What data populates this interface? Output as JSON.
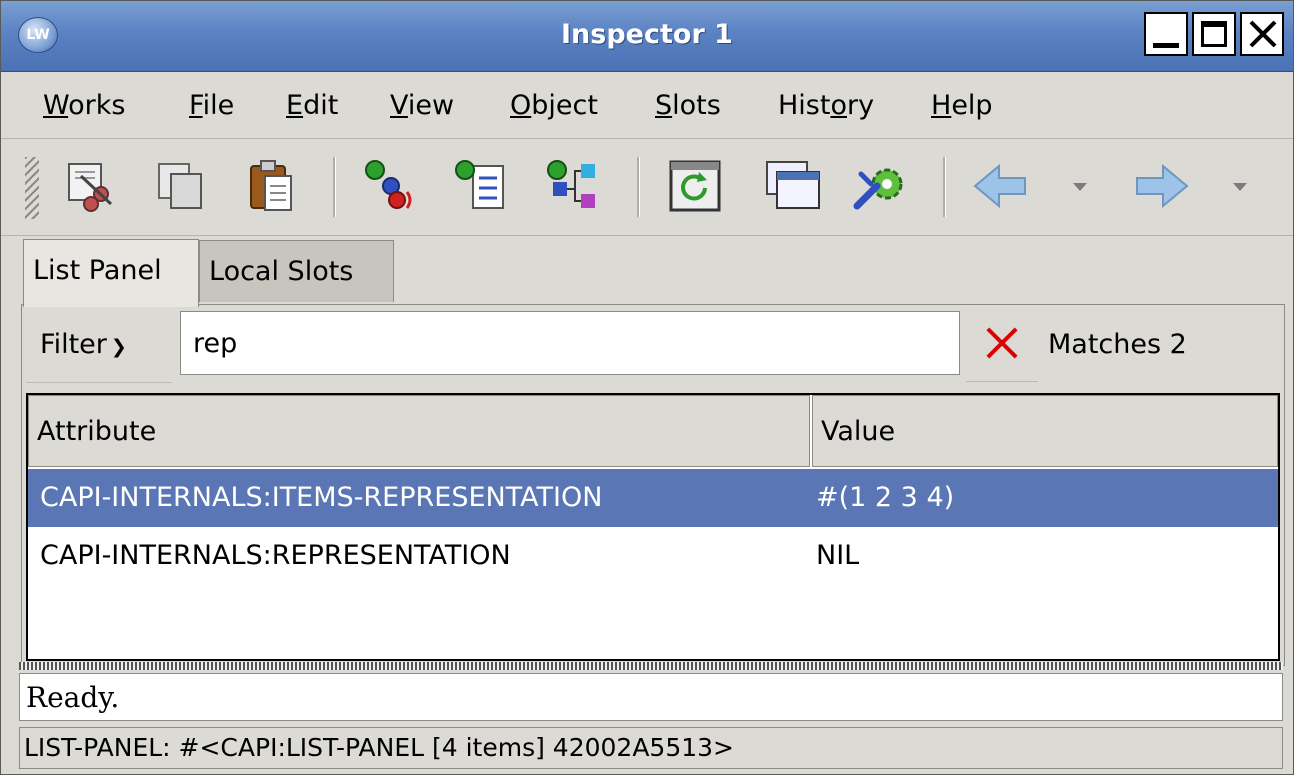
{
  "window": {
    "title": "Inspector 1",
    "app_icon_text": "LW"
  },
  "menu": [
    {
      "label": "Works",
      "mnemonic": "W",
      "rest": "orks"
    },
    {
      "label": "File",
      "mnemonic": "F",
      "rest": "ile"
    },
    {
      "label": "Edit",
      "mnemonic": "E",
      "rest": "dit"
    },
    {
      "label": "View",
      "mnemonic": "V",
      "rest": "iew"
    },
    {
      "label": "Object",
      "mnemonic": "O",
      "rest": "bject"
    },
    {
      "label": "Slots",
      "mnemonic": "S",
      "rest": "lots"
    },
    {
      "label": "History",
      "pre": "Hist",
      "mnemonic": "o",
      "rest": "ry"
    },
    {
      "label": "Help",
      "mnemonic": "H",
      "rest": "elp"
    }
  ],
  "toolbar": {
    "buttons": [
      "cut-icon",
      "copy-icon",
      "paste-icon",
      "inspect-object-icon",
      "list-items-icon",
      "tree-view-icon",
      "refresh-icon",
      "new-window-icon",
      "settings-icon",
      "back-arrow-icon",
      "forward-arrow-icon"
    ]
  },
  "tabs": [
    {
      "label": "List Panel",
      "active": true
    },
    {
      "label": "Local Slots",
      "active": false
    }
  ],
  "filter": {
    "button_label": "Filter",
    "value": "rep",
    "matches_text": "Matches 2"
  },
  "table": {
    "columns": [
      "Attribute",
      "Value"
    ],
    "rows": [
      {
        "attribute": "CAPI-INTERNALS:ITEMS-REPRESENTATION",
        "value": "#(1 2 3 4)",
        "selected": true
      },
      {
        "attribute": "CAPI-INTERNALS:REPRESENTATION",
        "value": "NIL",
        "selected": false
      }
    ]
  },
  "status": {
    "message": "Ready.",
    "object_line": "LIST-PANEL: #<CAPI:LIST-PANEL [4 items] 42002A5513>"
  },
  "colors": {
    "titlebar": "#5b83c3",
    "selection": "#5a76b5",
    "clear_x": "#e00000"
  }
}
